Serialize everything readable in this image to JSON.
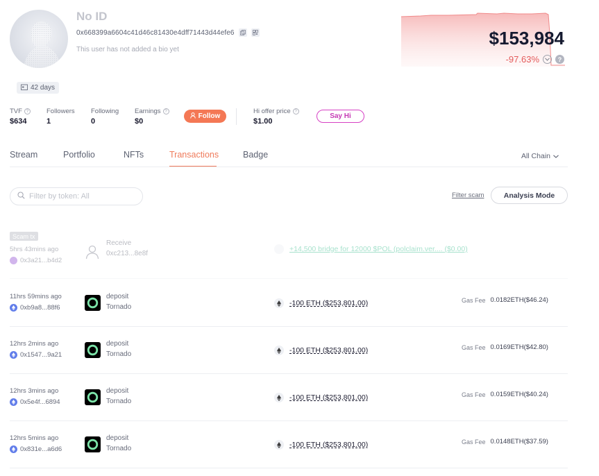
{
  "profile": {
    "name": "No ID",
    "address": "0x668399a6604c41d46c81430e4dff71443d44efe6",
    "bio": "This user has not added a bio yet",
    "days": "42 days"
  },
  "balance": {
    "value": "$153,984",
    "change": "-97.63%"
  },
  "stats": {
    "tvf_label": "TVF",
    "tvf_value": "$634",
    "followers_label": "Followers",
    "followers_value": "1",
    "following_label": "Following",
    "following_value": "0",
    "earnings_label": "Earnings",
    "earnings_value": "$0",
    "follow_label": "Follow",
    "hi_offer_label": "Hi offer price",
    "hi_offer_value": "$1.00",
    "sayhi_label": "Say Hi"
  },
  "tabs": [
    "Stream",
    "Portfolio",
    "NFTs",
    "Transactions",
    "Badge"
  ],
  "active_tab": "Transactions",
  "chain_selector": "All Chain",
  "filter": {
    "placeholder": "Filter by token: All",
    "filter_scam": "Filter scam",
    "analysis_mode": "Analysis Mode"
  },
  "scam_tx": {
    "tag": "Scam tx",
    "time": "5hrs 43mins ago",
    "hash": "0x3a21...b4d2",
    "action": "Receive",
    "from": "0xc213...8e8f",
    "amount": "+14,500 bridge for 12000 $POL (polclaim.ver.... ($0.00)"
  },
  "transactions": [
    {
      "time": "11hrs 59mins ago",
      "hash": "0xb9a8...88f6",
      "action": "deposit",
      "protocol": "Tornado",
      "amount": "-100 ETH ($253,801.00)",
      "gas_label": "Gas Fee",
      "gas_fee": "0.0182ETH($46.24)"
    },
    {
      "time": "12hrs 2mins ago",
      "hash": "0x1547...9a21",
      "action": "deposit",
      "protocol": "Tornado",
      "amount": "-100 ETH ($253,801.00)",
      "gas_label": "Gas Fee",
      "gas_fee": "0.0169ETH($42.80)"
    },
    {
      "time": "12hrs 3mins ago",
      "hash": "0x5e4f...6894",
      "action": "deposit",
      "protocol": "Tornado",
      "amount": "-100 ETH ($253,801.00)",
      "gas_label": "Gas Fee",
      "gas_fee": "0.0159ETH($40.24)"
    },
    {
      "time": "12hrs 5mins ago",
      "hash": "0x831e...a6d6",
      "action": "deposit",
      "protocol": "Tornado",
      "amount": "-100 ETH ($253,801.00)",
      "gas_label": "Gas Fee",
      "gas_fee": "0.0148ETH($37.59)"
    }
  ],
  "colors": {
    "accent": "#ef7a5a",
    "negative": "#e45b5b",
    "sayhi": "#c53ab4",
    "eth": "#627eea"
  },
  "icons": [
    "copy-icon",
    "qrcode-icon",
    "calendar-icon",
    "user-plus-icon",
    "chevron-down-icon",
    "search-icon",
    "eth-icon",
    "tornado-icon",
    "person-icon"
  ]
}
